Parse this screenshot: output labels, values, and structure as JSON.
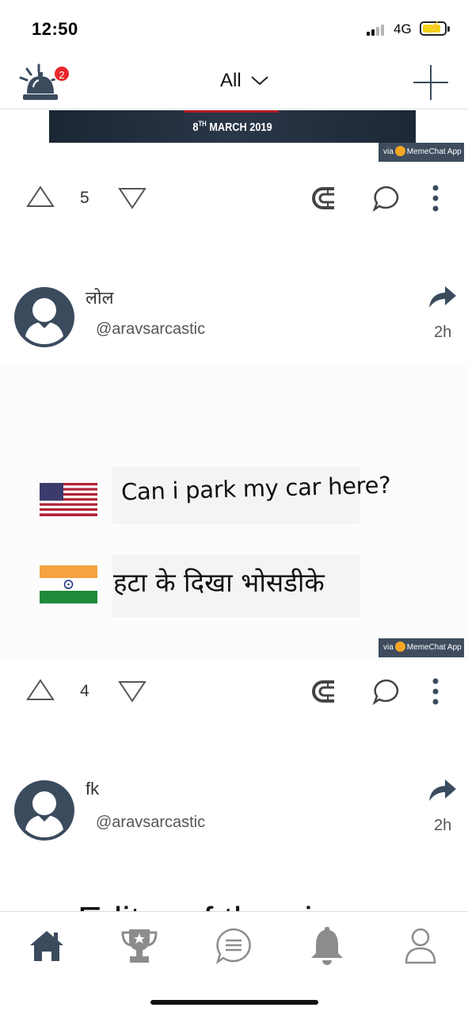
{
  "status_bar": {
    "time": "12:50",
    "network": "4G"
  },
  "header": {
    "filter_label": "All",
    "notification_count": "2"
  },
  "feed": {
    "post_prev": {
      "banner_date_day": "8",
      "banner_date_suffix": "TH",
      "banner_date_rest": " MARCH 2019",
      "watermark": "MemeChat App",
      "watermark_prefix": "via",
      "votes": "5"
    },
    "post_1": {
      "title": "लोल",
      "handle": "@aravsarcastic",
      "time": "2h",
      "meme_line_1": "Can i park my car here?",
      "meme_line_2": "हटा के दिखा भोसडीके",
      "watermark": "MemeChat App",
      "watermark_prefix": "via",
      "votes": "4"
    },
    "post_2": {
      "title": "fk",
      "handle": "@aravsarcastic",
      "time": "2h",
      "caption_partial": "Editor of the pic"
    }
  },
  "icons": {
    "notification": "service-bell-icon",
    "add": "plus-icon",
    "upvote": "triangle-up-icon",
    "downvote": "triangle-down-icon",
    "repost": "magnet-icon",
    "comment": "speech-bubble-icon",
    "more": "vertical-dots-icon",
    "share": "share-arrow-icon",
    "tabs": [
      "home-icon",
      "trophy-icon",
      "chat-icon",
      "bell-icon",
      "profile-icon"
    ]
  },
  "colors": {
    "accent": "#3b4b5e",
    "badge": "#e8262a",
    "inactive": "#8c8c8c"
  }
}
